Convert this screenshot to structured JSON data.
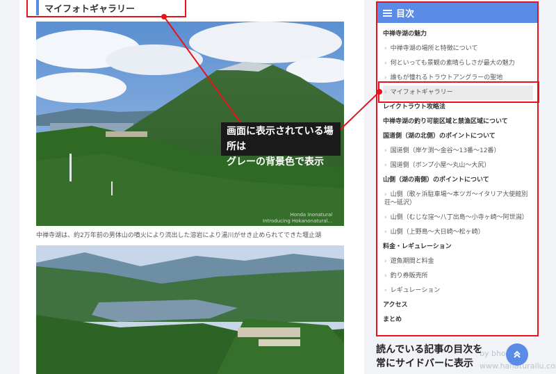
{
  "article": {
    "section_heading": "マイフォトギャラリー",
    "photo1_caption": "中禅寺湖は、約2万年前の男体山の噴火により流出した溶岩により湯川がせき止められてできた堰止湖",
    "photo_watermark": "Honda Inonatural\nIntroducing Hokanonatural..."
  },
  "annotation": {
    "line1": "画面に表示されている場所は",
    "line2": "グレーの背景色で表示"
  },
  "toc": {
    "title": "目次",
    "items": [
      {
        "label": "中禅寺湖の魅力",
        "level": 1,
        "active": false
      },
      {
        "label": "中禅寺湖の場所と特徴について",
        "level": 2,
        "active": false
      },
      {
        "label": "何といっても景観の素晴らしさが最大の魅力",
        "level": 2,
        "active": false
      },
      {
        "label": "誰もが憧れるトラウトアングラーの聖地",
        "level": 2,
        "active": false
      },
      {
        "label": "マイフォトギャラリー",
        "level": 2,
        "active": true
      },
      {
        "label": "レイクトラウト攻略法",
        "level": 1,
        "active": false
      },
      {
        "label": "中禅寺湖の釣り可能区域と禁漁区域について",
        "level": 1,
        "active": false
      },
      {
        "label": "国道側（湖の北側）のポイントについて",
        "level": 1,
        "active": false
      },
      {
        "label": "国道側（岸ケ渕〜金谷〜13番〜12番）",
        "level": 2,
        "active": false
      },
      {
        "label": "国道側（ボンプ小屋〜丸山〜大尻）",
        "level": 2,
        "active": false
      },
      {
        "label": "山側（湖の南側）のポイントについて",
        "level": 1,
        "active": false
      },
      {
        "label": "山側（歌ヶ浜駐車場〜本ツガ〜イタリア大使館別荘〜砥沢）",
        "level": 2,
        "active": false
      },
      {
        "label": "山側（むじな窪〜八丁出島〜小寺ヶ崎〜阿世潟）",
        "level": 2,
        "active": false
      },
      {
        "label": "山側（上野島〜大日崎〜松ヶ崎）",
        "level": 2,
        "active": false
      },
      {
        "label": "料金・レギュレーション",
        "level": 1,
        "active": false
      },
      {
        "label": "遊魚期間と料金",
        "level": 2,
        "active": false
      },
      {
        "label": "釣り券販売所",
        "level": 2,
        "active": false
      },
      {
        "label": "レギュレーション",
        "level": 2,
        "active": false
      },
      {
        "label": "アクセス",
        "level": 1,
        "active": false
      },
      {
        "label": "まとめ",
        "level": 1,
        "active": false
      }
    ]
  },
  "sidebar_note": {
    "line1": "読んでいる記事の目次を",
    "line2": "常にサイドバーに表示"
  },
  "site_watermark": "by bhorizou\nwww.hanaturailu.com",
  "colors": {
    "accent": "#5a8be6",
    "callout_red": "#e8121b",
    "annotation_bg": "#1a1a1a"
  },
  "icons": [
    "list-icon",
    "chevron-up-icon"
  ]
}
